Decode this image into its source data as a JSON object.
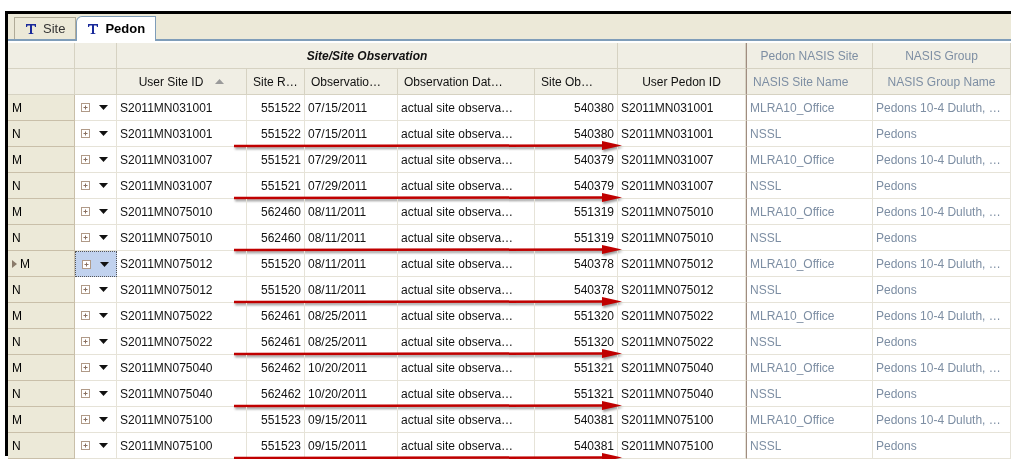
{
  "tabs": [
    {
      "label": "Site",
      "selected": false
    },
    {
      "label": "Pedon",
      "selected": true
    }
  ],
  "column_groups": [
    {
      "label": "Site/Site Observation",
      "dimmed": false
    },
    {
      "label": "Pedon NASIS Site",
      "dimmed": true
    },
    {
      "label": "NASIS Group",
      "dimmed": true
    }
  ],
  "columns": [
    {
      "label": "User Site ID",
      "sorted": true,
      "numeric": false,
      "dimmed": false
    },
    {
      "label": "Site R…",
      "numeric": true,
      "dimmed": false
    },
    {
      "label": "Observatio…",
      "numeric": false,
      "dimmed": false
    },
    {
      "label": "Observation Dat…",
      "numeric": false,
      "dimmed": false
    },
    {
      "label": "Site Ob…",
      "numeric": true,
      "dimmed": false
    },
    {
      "label": "User Pedon ID",
      "numeric": false,
      "dimmed": false
    },
    {
      "label": "NASIS Site Name",
      "numeric": false,
      "dimmed": true
    },
    {
      "label": "NASIS Group Name",
      "numeric": false,
      "dimmed": true
    }
  ],
  "rows": [
    {
      "marker": "M",
      "selected": false,
      "annotated": false,
      "cells": [
        "S2011MN031001",
        "551522",
        "07/15/2011",
        "actual site observa…",
        "540380",
        "S2011MN031001",
        "MLRA10_Office",
        "Pedons 10-4 Duluth, …"
      ]
    },
    {
      "marker": "N",
      "selected": false,
      "annotated": true,
      "cells": [
        "S2011MN031001",
        "551522",
        "07/15/2011",
        "actual site observa…",
        "540380",
        "S2011MN031001",
        "NSSL",
        "Pedons"
      ]
    },
    {
      "marker": "M",
      "selected": false,
      "annotated": false,
      "cells": [
        "S2011MN031007",
        "551521",
        "07/29/2011",
        "actual site observa…",
        "540379",
        "S2011MN031007",
        "MLRA10_Office",
        "Pedons 10-4 Duluth, …"
      ]
    },
    {
      "marker": "N",
      "selected": false,
      "annotated": true,
      "cells": [
        "S2011MN031007",
        "551521",
        "07/29/2011",
        "actual site observa…",
        "540379",
        "S2011MN031007",
        "NSSL",
        "Pedons"
      ]
    },
    {
      "marker": "M",
      "selected": false,
      "annotated": false,
      "cells": [
        "S2011MN075010",
        "562460",
        "08/11/2011",
        "actual site observa…",
        "551319",
        "S2011MN075010",
        "MLRA10_Office",
        "Pedons 10-4 Duluth, …"
      ]
    },
    {
      "marker": "N",
      "selected": false,
      "annotated": true,
      "cells": [
        "S2011MN075010",
        "562460",
        "08/11/2011",
        "actual site observa…",
        "551319",
        "S2011MN075010",
        "NSSL",
        "Pedons"
      ]
    },
    {
      "marker": "M",
      "selected": true,
      "annotated": false,
      "cells": [
        "S2011MN075012",
        "551520",
        "08/11/2011",
        "actual site observa…",
        "540378",
        "S2011MN075012",
        "MLRA10_Office",
        "Pedons 10-4 Duluth, …"
      ]
    },
    {
      "marker": "N",
      "selected": false,
      "annotated": true,
      "cells": [
        "S2011MN075012",
        "551520",
        "08/11/2011",
        "actual site observa…",
        "540378",
        "S2011MN075012",
        "NSSL",
        "Pedons"
      ]
    },
    {
      "marker": "M",
      "selected": false,
      "annotated": false,
      "cells": [
        "S2011MN075022",
        "562461",
        "08/25/2011",
        "actual site observa…",
        "551320",
        "S2011MN075022",
        "MLRA10_Office",
        "Pedons 10-4 Duluth, …"
      ]
    },
    {
      "marker": "N",
      "selected": false,
      "annotated": true,
      "cells": [
        "S2011MN075022",
        "562461",
        "08/25/2011",
        "actual site observa…",
        "551320",
        "S2011MN075022",
        "NSSL",
        "Pedons"
      ]
    },
    {
      "marker": "M",
      "selected": false,
      "annotated": false,
      "cells": [
        "S2011MN075040",
        "562462",
        "10/20/2011",
        "actual site observa…",
        "551321",
        "S2011MN075040",
        "MLRA10_Office",
        "Pedons 10-4 Duluth, …"
      ]
    },
    {
      "marker": "N",
      "selected": false,
      "annotated": true,
      "cells": [
        "S2011MN075040",
        "562462",
        "10/20/2011",
        "actual site observa…",
        "551321",
        "S2011MN075040",
        "NSSL",
        "Pedons"
      ]
    },
    {
      "marker": "M",
      "selected": false,
      "annotated": false,
      "cells": [
        "S2011MN075100",
        "551523",
        "09/15/2011",
        "actual site observa…",
        "540381",
        "S2011MN075100",
        "MLRA10_Office",
        "Pedons 10-4 Duluth, …"
      ]
    },
    {
      "marker": "N",
      "selected": false,
      "annotated": true,
      "cells": [
        "S2011MN075100",
        "551523",
        "09/15/2011",
        "actual site observa…",
        "540381",
        "S2011MN075100",
        "NSSL",
        "Pedons"
      ]
    }
  ]
}
